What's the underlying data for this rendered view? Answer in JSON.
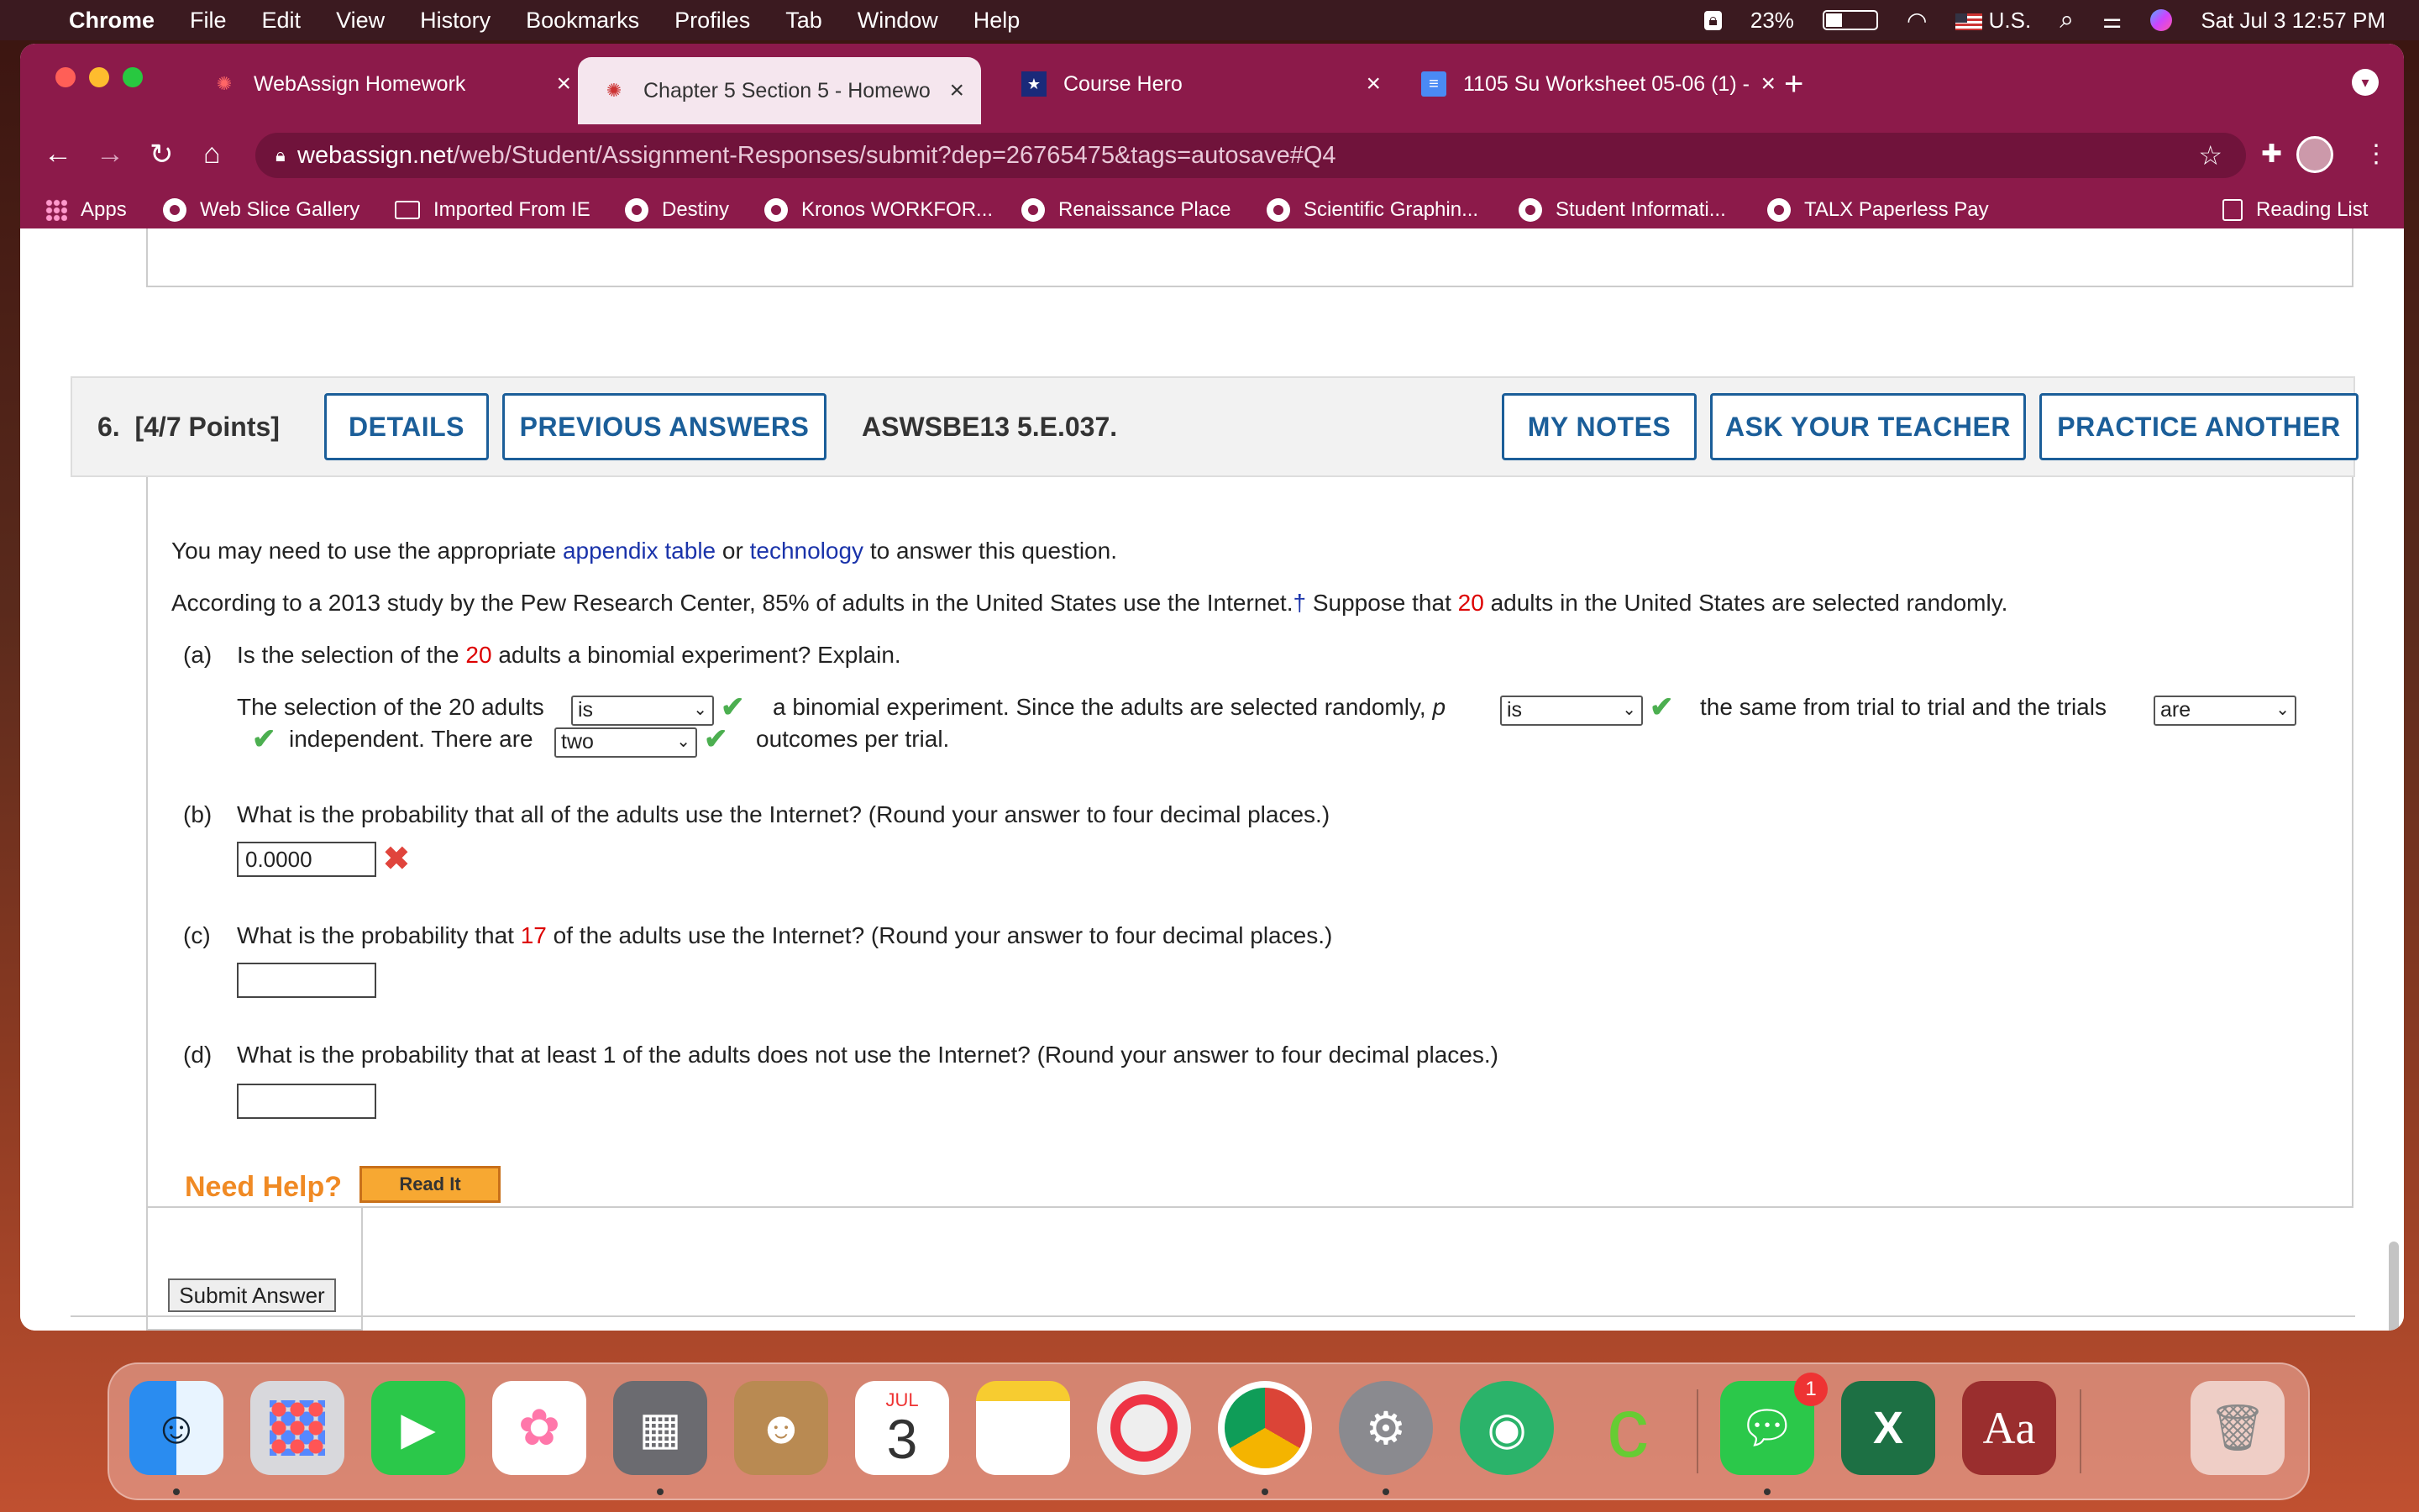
{
  "menubar": {
    "items": [
      "Chrome",
      "File",
      "Edit",
      "View",
      "History",
      "Bookmarks",
      "Profiles",
      "Tab",
      "Window",
      "Help"
    ],
    "battery": "23%",
    "input_source": "U.S.",
    "datetime": "Sat Jul 3  12:57 PM"
  },
  "tabs": [
    {
      "title": "WebAssign Homework"
    },
    {
      "title": "Chapter 5 Section 5 - Homewo"
    },
    {
      "title": "Course Hero"
    },
    {
      "title": "1105 Su Worksheet 05-06 (1) -"
    }
  ],
  "address": {
    "host": "webassign.net",
    "path": "/web/Student/Assignment-Responses/submit?dep=26765475&tags=autosave#Q4"
  },
  "bookmarks": [
    "Apps",
    "Web Slice Gallery",
    "Imported From IE",
    "Destiny",
    "Kronos WORKFOR...",
    "Renaissance Place",
    "Scientific Graphin...",
    "Student Informati...",
    "TALX Paperless Pay",
    "Reading List"
  ],
  "question": {
    "number": "6.",
    "points": "[4/7 Points]",
    "details": "DETAILS",
    "previous_answers": "PREVIOUS ANSWERS",
    "code": "ASWSBE13 5.E.037.",
    "my_notes": "MY NOTES",
    "ask_teacher": "ASK YOUR TEACHER",
    "practice_another": "PRACTICE ANOTHER",
    "intro_pre": "You may need to use the appropriate",
    "intro_link1": "appendix table",
    "intro_or": "or",
    "intro_link2": "technology",
    "intro_post": "to answer this question.",
    "stem_pre": "According to a 2013 study by the Pew Research Center, 85% of adults in the United States use the Internet.",
    "stem_dagger": "†",
    "stem_mid": "Suppose that",
    "stem_n": "20",
    "stem_post": "adults in the United States are selected randomly.",
    "a_label": "(a)",
    "a_q_pre": "Is the selection of the",
    "a_q_n": "20",
    "a_q_post": "adults a binomial experiment? Explain.",
    "a_s1": "The selection of the 20 adults",
    "a_sel1": "is",
    "a_s2": "a binomial experiment. Since the adults are selected randomly,",
    "a_p": "p",
    "a_sel2": "is",
    "a_s3": "the same from trial to trial and the trials",
    "a_sel3": "are",
    "a_s4": "independent. There are",
    "a_sel4": "two",
    "a_s5": "outcomes per trial.",
    "b_label": "(b)",
    "b_q": "What is the probability that all of the adults use the Internet? (Round your answer to four decimal places.)",
    "b_answer": "0.0000",
    "c_label": "(c)",
    "c_q_pre": "What is the probability that",
    "c_q_n": "17",
    "c_q_post": "of the adults use the Internet? (Round your answer to four decimal places.)",
    "c_answer": "",
    "d_label": "(d)",
    "d_q": "What is the probability that at least 1 of the adults does not use the Internet? (Round your answer to four decimal places.)",
    "d_answer": "",
    "need_help": "Need Help?",
    "read_it": "Read It",
    "submit": "Submit Answer"
  },
  "dock": {
    "calendar_month": "JUL",
    "calendar_day": "3",
    "messages_badge": "1",
    "dictionary_label": "Aa"
  },
  "colors": {
    "chrome_theme": "#8c1a4a",
    "webassign_blue": "#1b5e99",
    "highlight_red": "#dd0000",
    "correct_green": "#4caf50",
    "incorrect_red": "#e0443c",
    "need_help_orange": "#f08a24"
  }
}
